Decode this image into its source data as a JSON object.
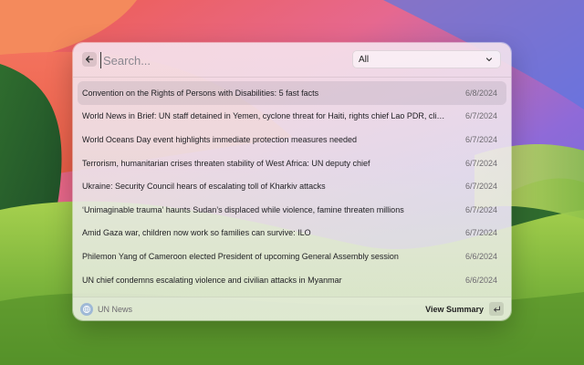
{
  "search": {
    "placeholder": "Search...",
    "value": "",
    "back_icon": "arrow-left-icon"
  },
  "filter": {
    "selected": "All",
    "icon": "chevron-down-icon"
  },
  "results": [
    {
      "title": "Convention on the Rights of Persons with Disabilities: 5 fast facts",
      "date": "6/8/2024",
      "selected": true
    },
    {
      "title": "World News in Brief: UN staff detained in Yemen, cyclone threat for Haiti, rights chief Lao PDR, climat...",
      "date": "6/7/2024"
    },
    {
      "title": "World Oceans Day event highlights immediate protection measures needed",
      "date": "6/7/2024"
    },
    {
      "title": "Terrorism, humanitarian crises threaten stability of West Africa: UN deputy chief",
      "date": "6/7/2024"
    },
    {
      "title": "Ukraine: Security Council hears of escalating toll of Kharkiv attacks",
      "date": "6/7/2024"
    },
    {
      "title": "‘Unimaginable trauma’ haunts Sudan’s displaced while violence, famine threaten millions",
      "date": "6/7/2024"
    },
    {
      "title": "Amid Gaza war, children now work so families can survive: ILO",
      "date": "6/7/2024"
    },
    {
      "title": "Philemon Yang of Cameroon elected President of upcoming General Assembly session",
      "date": "6/6/2024"
    },
    {
      "title": "UN chief condemns escalating violence and civilian attacks in Myanmar",
      "date": "6/6/2024"
    }
  ],
  "footer": {
    "source_name": "UN News",
    "source_icon": "un-globe-icon",
    "action_label": "View Summary",
    "action_icon": "enter-key-icon"
  },
  "colors": {
    "selected_row": "#dcd3dc",
    "accent": "#222222"
  }
}
